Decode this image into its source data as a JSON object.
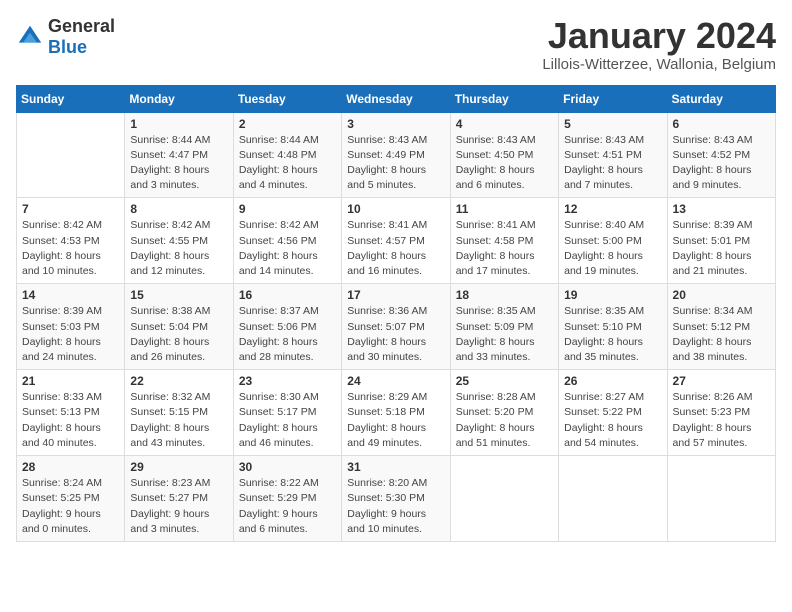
{
  "logo": {
    "general": "General",
    "blue": "Blue"
  },
  "title": "January 2024",
  "subtitle": "Lillois-Witterzee, Wallonia, Belgium",
  "header": {
    "days": [
      "Sunday",
      "Monday",
      "Tuesday",
      "Wednesday",
      "Thursday",
      "Friday",
      "Saturday"
    ]
  },
  "weeks": [
    [
      {
        "day": "",
        "sunrise": "",
        "sunset": "",
        "daylight": ""
      },
      {
        "day": "1",
        "sunrise": "Sunrise: 8:44 AM",
        "sunset": "Sunset: 4:47 PM",
        "daylight": "Daylight: 8 hours and 3 minutes."
      },
      {
        "day": "2",
        "sunrise": "Sunrise: 8:44 AM",
        "sunset": "Sunset: 4:48 PM",
        "daylight": "Daylight: 8 hours and 4 minutes."
      },
      {
        "day": "3",
        "sunrise": "Sunrise: 8:43 AM",
        "sunset": "Sunset: 4:49 PM",
        "daylight": "Daylight: 8 hours and 5 minutes."
      },
      {
        "day": "4",
        "sunrise": "Sunrise: 8:43 AM",
        "sunset": "Sunset: 4:50 PM",
        "daylight": "Daylight: 8 hours and 6 minutes."
      },
      {
        "day": "5",
        "sunrise": "Sunrise: 8:43 AM",
        "sunset": "Sunset: 4:51 PM",
        "daylight": "Daylight: 8 hours and 7 minutes."
      },
      {
        "day": "6",
        "sunrise": "Sunrise: 8:43 AM",
        "sunset": "Sunset: 4:52 PM",
        "daylight": "Daylight: 8 hours and 9 minutes."
      }
    ],
    [
      {
        "day": "7",
        "sunrise": "Sunrise: 8:42 AM",
        "sunset": "Sunset: 4:53 PM",
        "daylight": "Daylight: 8 hours and 10 minutes."
      },
      {
        "day": "8",
        "sunrise": "Sunrise: 8:42 AM",
        "sunset": "Sunset: 4:55 PM",
        "daylight": "Daylight: 8 hours and 12 minutes."
      },
      {
        "day": "9",
        "sunrise": "Sunrise: 8:42 AM",
        "sunset": "Sunset: 4:56 PM",
        "daylight": "Daylight: 8 hours and 14 minutes."
      },
      {
        "day": "10",
        "sunrise": "Sunrise: 8:41 AM",
        "sunset": "Sunset: 4:57 PM",
        "daylight": "Daylight: 8 hours and 16 minutes."
      },
      {
        "day": "11",
        "sunrise": "Sunrise: 8:41 AM",
        "sunset": "Sunset: 4:58 PM",
        "daylight": "Daylight: 8 hours and 17 minutes."
      },
      {
        "day": "12",
        "sunrise": "Sunrise: 8:40 AM",
        "sunset": "Sunset: 5:00 PM",
        "daylight": "Daylight: 8 hours and 19 minutes."
      },
      {
        "day": "13",
        "sunrise": "Sunrise: 8:39 AM",
        "sunset": "Sunset: 5:01 PM",
        "daylight": "Daylight: 8 hours and 21 minutes."
      }
    ],
    [
      {
        "day": "14",
        "sunrise": "Sunrise: 8:39 AM",
        "sunset": "Sunset: 5:03 PM",
        "daylight": "Daylight: 8 hours and 24 minutes."
      },
      {
        "day": "15",
        "sunrise": "Sunrise: 8:38 AM",
        "sunset": "Sunset: 5:04 PM",
        "daylight": "Daylight: 8 hours and 26 minutes."
      },
      {
        "day": "16",
        "sunrise": "Sunrise: 8:37 AM",
        "sunset": "Sunset: 5:06 PM",
        "daylight": "Daylight: 8 hours and 28 minutes."
      },
      {
        "day": "17",
        "sunrise": "Sunrise: 8:36 AM",
        "sunset": "Sunset: 5:07 PM",
        "daylight": "Daylight: 8 hours and 30 minutes."
      },
      {
        "day": "18",
        "sunrise": "Sunrise: 8:35 AM",
        "sunset": "Sunset: 5:09 PM",
        "daylight": "Daylight: 8 hours and 33 minutes."
      },
      {
        "day": "19",
        "sunrise": "Sunrise: 8:35 AM",
        "sunset": "Sunset: 5:10 PM",
        "daylight": "Daylight: 8 hours and 35 minutes."
      },
      {
        "day": "20",
        "sunrise": "Sunrise: 8:34 AM",
        "sunset": "Sunset: 5:12 PM",
        "daylight": "Daylight: 8 hours and 38 minutes."
      }
    ],
    [
      {
        "day": "21",
        "sunrise": "Sunrise: 8:33 AM",
        "sunset": "Sunset: 5:13 PM",
        "daylight": "Daylight: 8 hours and 40 minutes."
      },
      {
        "day": "22",
        "sunrise": "Sunrise: 8:32 AM",
        "sunset": "Sunset: 5:15 PM",
        "daylight": "Daylight: 8 hours and 43 minutes."
      },
      {
        "day": "23",
        "sunrise": "Sunrise: 8:30 AM",
        "sunset": "Sunset: 5:17 PM",
        "daylight": "Daylight: 8 hours and 46 minutes."
      },
      {
        "day": "24",
        "sunrise": "Sunrise: 8:29 AM",
        "sunset": "Sunset: 5:18 PM",
        "daylight": "Daylight: 8 hours and 49 minutes."
      },
      {
        "day": "25",
        "sunrise": "Sunrise: 8:28 AM",
        "sunset": "Sunset: 5:20 PM",
        "daylight": "Daylight: 8 hours and 51 minutes."
      },
      {
        "day": "26",
        "sunrise": "Sunrise: 8:27 AM",
        "sunset": "Sunset: 5:22 PM",
        "daylight": "Daylight: 8 hours and 54 minutes."
      },
      {
        "day": "27",
        "sunrise": "Sunrise: 8:26 AM",
        "sunset": "Sunset: 5:23 PM",
        "daylight": "Daylight: 8 hours and 57 minutes."
      }
    ],
    [
      {
        "day": "28",
        "sunrise": "Sunrise: 8:24 AM",
        "sunset": "Sunset: 5:25 PM",
        "daylight": "Daylight: 9 hours and 0 minutes."
      },
      {
        "day": "29",
        "sunrise": "Sunrise: 8:23 AM",
        "sunset": "Sunset: 5:27 PM",
        "daylight": "Daylight: 9 hours and 3 minutes."
      },
      {
        "day": "30",
        "sunrise": "Sunrise: 8:22 AM",
        "sunset": "Sunset: 5:29 PM",
        "daylight": "Daylight: 9 hours and 6 minutes."
      },
      {
        "day": "31",
        "sunrise": "Sunrise: 8:20 AM",
        "sunset": "Sunset: 5:30 PM",
        "daylight": "Daylight: 9 hours and 10 minutes."
      },
      {
        "day": "",
        "sunrise": "",
        "sunset": "",
        "daylight": ""
      },
      {
        "day": "",
        "sunrise": "",
        "sunset": "",
        "daylight": ""
      },
      {
        "day": "",
        "sunrise": "",
        "sunset": "",
        "daylight": ""
      }
    ]
  ]
}
